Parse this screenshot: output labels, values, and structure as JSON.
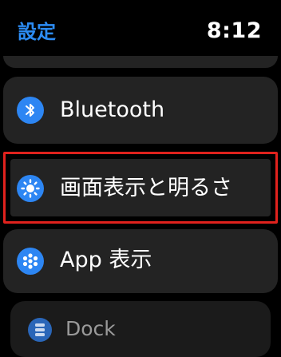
{
  "header": {
    "back_label": "設定",
    "time": "8:12"
  },
  "settings_list": {
    "items": [
      {
        "label": "Bluetooth",
        "icon": "bluetooth-icon"
      },
      {
        "label": "画面表示と明るさ",
        "icon": "sun-icon",
        "highlighted": true
      },
      {
        "label": "App 表示",
        "icon": "app-grid-icon"
      },
      {
        "label": "Dock",
        "icon": "dock-icon",
        "dimmed": true
      }
    ]
  },
  "colors": {
    "accent": "#2c8cf4",
    "highlight_border": "#e0221d",
    "row_background": "#232323"
  }
}
